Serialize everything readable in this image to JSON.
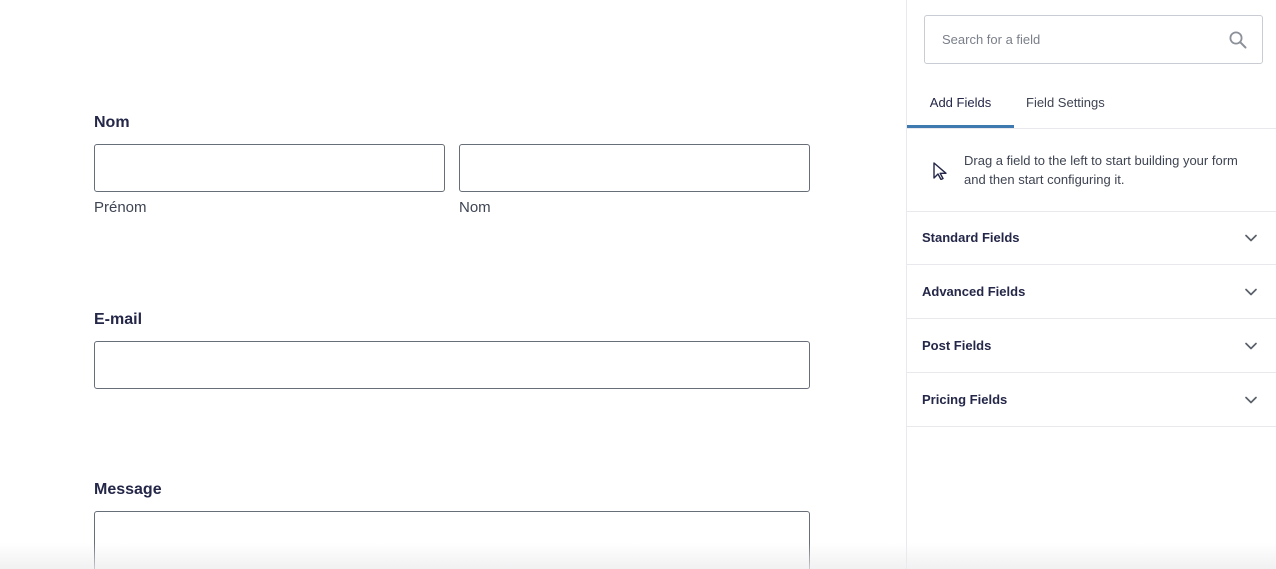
{
  "form": {
    "name_field": {
      "label": "Nom",
      "first_sublabel": "Prénom",
      "last_sublabel": "Nom"
    },
    "email_field": {
      "label": "E-mail"
    },
    "message_field": {
      "label": "Message"
    }
  },
  "sidebar": {
    "search": {
      "placeholder": "Search for a field",
      "icon": "search-icon"
    },
    "tabs": [
      {
        "label": "Add Fields",
        "active": true
      },
      {
        "label": "Field Settings",
        "active": false
      }
    ],
    "notice": {
      "icon": "cursor-icon",
      "text": "Drag a field to the left to start building your form and then start configuring it."
    },
    "sections": [
      {
        "label": "Standard Fields",
        "icon": "chevron-down-icon"
      },
      {
        "label": "Advanced Fields",
        "icon": "chevron-down-icon"
      },
      {
        "label": "Post Fields",
        "icon": "chevron-down-icon"
      },
      {
        "label": "Pricing Fields",
        "icon": "chevron-down-icon"
      }
    ]
  },
  "colors": {
    "text": "#242748",
    "accent": "#3e7ab0",
    "border": "#686e77",
    "divider": "#e8e9ec"
  }
}
